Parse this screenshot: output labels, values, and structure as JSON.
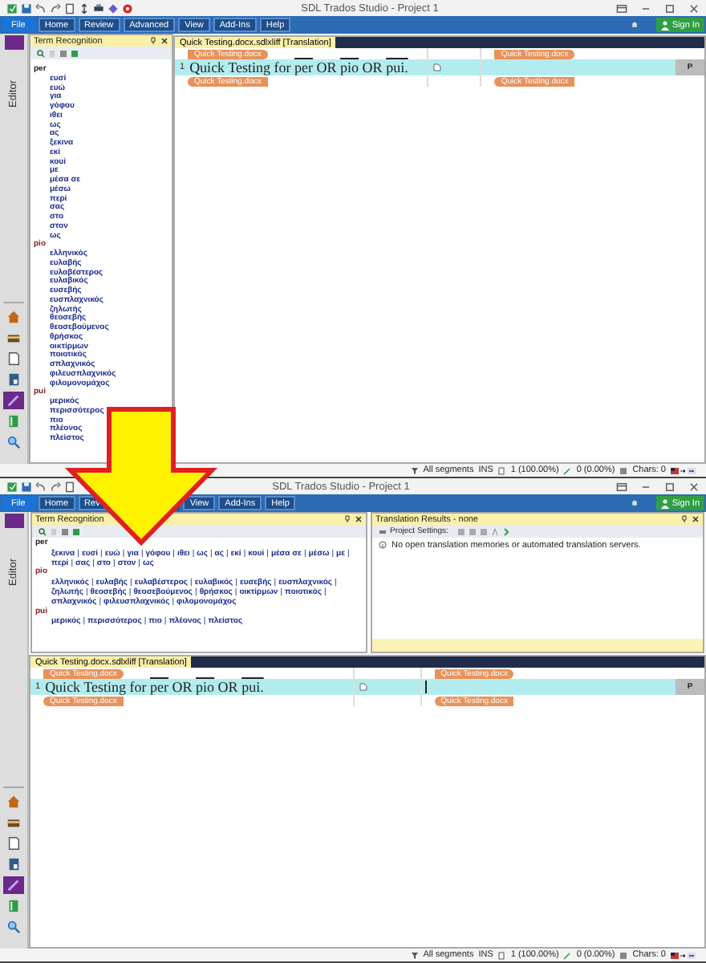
{
  "screens": [
    {
      "kind": "side",
      "window": {
        "title": "SDL Trados Studio - Project 1"
      },
      "ribbon": {
        "tabs": [
          {
            "label": "File",
            "kind": "backstage"
          },
          {
            "label": "Home",
            "kind": "tab"
          },
          {
            "label": "Review",
            "kind": "tab"
          },
          {
            "label": "Advanced",
            "kind": "tab"
          },
          {
            "label": "View",
            "kind": "tab"
          },
          {
            "label": "Add-Ins",
            "kind": "tab"
          },
          {
            "label": "Help",
            "kind": "tab"
          }
        ],
        "sign_in": "Sign In"
      },
      "sidebar": {
        "label": "Editor",
        "views": [
          {
            "kind": "home",
            "selected": false
          },
          {
            "kind": "projects",
            "selected": false
          },
          {
            "kind": "files",
            "selected": false
          },
          {
            "kind": "reports",
            "selected": false
          },
          {
            "kind": "editor",
            "selected": true
          },
          {
            "kind": "termbase",
            "selected": false
          },
          {
            "kind": "search",
            "selected": false
          }
        ]
      },
      "term_recognition": {
        "title": "Term Recognition",
        "groups": [
          {
            "term": "per",
            "translations": [
              "ευσί",
              "ευώ",
              "για",
              "γόφου",
              "ιθει",
              "ως",
              "ας",
              "ξεκινα",
              "εκί",
              "κουί",
              "με",
              "μέσα σε",
              "μέσω",
              "περί",
              "σας",
              "στο",
              "στον",
              "ως"
            ]
          },
          {
            "term": "pio",
            "translations": [
              "ελληνικός",
              "ευλαβής",
              "ευλαβέστερος",
              "ευλαβικός",
              "ευσεβής",
              "ευσπλαχνικός",
              "ζηλωτής",
              "θεοσεβής",
              "θεοσεβούμενος",
              "θρήσκος",
              "οικτίρμων",
              "ποιοτικός",
              "σπλαχνικός",
              "φιλευσπλαχνικός",
              "φιλομονομάχος"
            ]
          },
          {
            "term": "pui",
            "translations": [
              "μερικός",
              "περισσότερος",
              "πιο",
              "πλέονος",
              "πλείστος"
            ]
          }
        ]
      },
      "editor": {
        "tab": "Quick Testing.docx.sdlxliff [Translation]",
        "segments": [
          {
            "number": "1",
            "selected": true,
            "cursor": false,
            "status": "P",
            "source_open_tag": "Quick Testing.docx",
            "source_close_tag": "Quick Testing.docx",
            "target_open_tag": "Quick Testing.docx",
            "target_close_tag": "Quick Testing.docx",
            "source": [
              {
                "text": "Quick Testing for ",
                "term": false
              },
              {
                "text": "per",
                "term": true
              },
              {
                "text": " OR ",
                "term": false
              },
              {
                "text": "pio",
                "term": true
              },
              {
                "text": " OR ",
                "term": false
              },
              {
                "text": "pui.",
                "term": true
              }
            ]
          }
        ]
      },
      "status_bar": {
        "filter": "All segments",
        "mode": "INS",
        "translated": "1 (100.00%)",
        "draft": "0 (0.00%)",
        "chars": "Chars: 0"
      }
    },
    {
      "kind": "docked",
      "window": {
        "title": "SDL Trados Studio - Project 1"
      },
      "ribbon": {
        "tabs": [
          {
            "label": "File",
            "kind": "backstage"
          },
          {
            "label": "Home",
            "kind": "tab"
          },
          {
            "label": "Rev",
            "kind": "tab"
          },
          {
            "kind": "covered"
          },
          {
            "label": "View",
            "kind": "tab"
          },
          {
            "label": "Add-Ins",
            "kind": "tab"
          },
          {
            "label": "Help",
            "kind": "tab"
          }
        ],
        "sign_in": "Sign In"
      },
      "sidebar": {
        "label": "Editor",
        "views": [
          {
            "kind": "home",
            "selected": false
          },
          {
            "kind": "projects",
            "selected": false
          },
          {
            "kind": "files",
            "selected": false
          },
          {
            "kind": "reports",
            "selected": false
          },
          {
            "kind": "editor",
            "selected": true
          },
          {
            "kind": "termbase",
            "selected": false
          },
          {
            "kind": "search",
            "selected": false
          }
        ]
      },
      "term_recognition": {
        "title": "Term Recognition",
        "separator": "|",
        "groups": [
          {
            "term": "per",
            "translations": [
              "ξεκινα",
              "ευσί",
              "ευώ",
              "για",
              "γόφου",
              "ιθει",
              "ως",
              "ας",
              "εκί",
              "κουί",
              "μέσα σε",
              "μέσω",
              "με",
              "περί",
              "σας",
              "στο",
              "στον",
              "ως"
            ]
          },
          {
            "term": "pio",
            "translations": [
              "ελληνικός",
              "ευλαβής",
              "ευλαβέστερος",
              "ευλαβικός",
              "ευσεβής",
              "ευσπλαχνικός",
              "ζηλωτής",
              "θεοσεβής",
              "θεοσεβούμενος",
              "θρήσκος",
              "οικτίρμων",
              "ποιοτικός",
              "σπλαχνικός",
              "φιλευσπλαχνικός",
              "φιλομονομάχος"
            ]
          },
          {
            "term": "pui",
            "translations": [
              "μερικός",
              "περισσότερος",
              "πιο",
              "πλέονος",
              "πλείστος"
            ]
          }
        ]
      },
      "translation_results": {
        "title": "Translation Results - none",
        "toolbar_label": "Project Settings:",
        "message": "No open translation memories or automated translation servers."
      },
      "editor": {
        "tab": "Quick Testing.docx.sdlxliff [Translation]",
        "segments": [
          {
            "number": "1",
            "selected": true,
            "cursor": true,
            "status": "P",
            "source_open_tag": "Quick Testing.docx",
            "source_close_tag": "Quick Testing.docx",
            "target_open_tag": "Quick Testing.docx",
            "target_close_tag": "Quick Testing.docx",
            "source": [
              {
                "text": "Quick Testing for ",
                "term": false
              },
              {
                "text": "per",
                "term": true
              },
              {
                "text": " OR ",
                "term": false
              },
              {
                "text": "pio",
                "term": true
              },
              {
                "text": " OR ",
                "term": false
              },
              {
                "text": "pui.",
                "term": true
              }
            ]
          }
        ]
      },
      "status_bar": {
        "filter": "All segments",
        "mode": "INS",
        "translated": "1 (100.00%)",
        "draft": "0 (0.00%)",
        "chars": "Chars: 0"
      }
    }
  ]
}
